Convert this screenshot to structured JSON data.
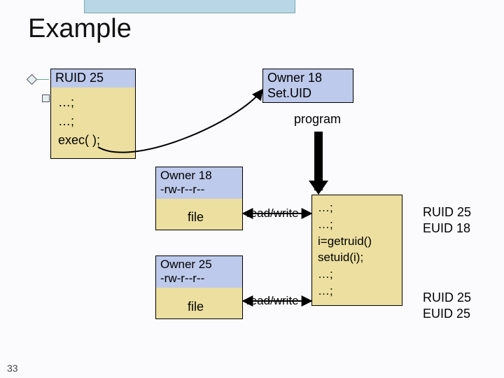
{
  "title": "Example",
  "page_number": "33",
  "proc_a": {
    "header": "RUID 25",
    "lines": [
      "…;",
      "…;",
      "exec(  );"
    ]
  },
  "setuid_box": {
    "line1": "Owner 18",
    "line2": "Set.UID"
  },
  "program_label": "program",
  "file1": {
    "owner": "Owner 18",
    "perms": "-rw-r--r--",
    "word": "file"
  },
  "file2": {
    "owner": "Owner 25",
    "perms": "-rw-r--r--",
    "word": "file"
  },
  "rw1_label": "read/write",
  "rw2_label": "read/write",
  "prog_run": {
    "lines": [
      "…;",
      "…;",
      "i=getruid()",
      "setuid(i);",
      "…;",
      "…;"
    ]
  },
  "ids1": {
    "ruid": "RUID 25",
    "euid": "EUID 18"
  },
  "ids2": {
    "ruid": "RUID 25",
    "euid": "EUID 25"
  }
}
